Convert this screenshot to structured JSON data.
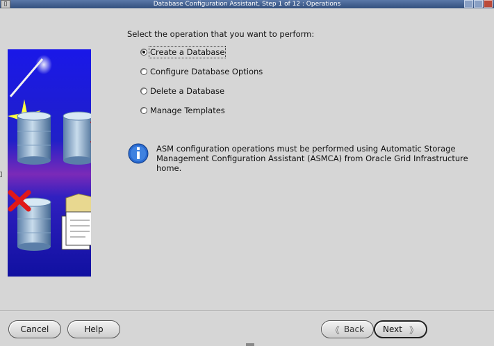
{
  "window": {
    "title": "Database Configuration Assistant, Step 1 of 12 : Operations",
    "icon_glyph": "▯"
  },
  "prompt": "Select the operation that you want to perform:",
  "options": [
    {
      "label": "Create a Database",
      "selected": true
    },
    {
      "label": "Configure Database Options",
      "selected": false
    },
    {
      "label": "Delete a Database",
      "selected": false
    },
    {
      "label": "Manage Templates",
      "selected": false
    }
  ],
  "info": {
    "icon": "info-icon",
    "line1": "ASM configuration operations must be performed using Automatic Storage",
    "line2": "Management Configuration Assistant (ASMCA) from Oracle Grid Infrastructure home."
  },
  "buttons": {
    "cancel": "Cancel",
    "help": "Help",
    "back": "Back",
    "next": "Next",
    "back_arrow": "《",
    "next_arrow": "》"
  },
  "colors": {
    "title_bar": "#3d5a8a",
    "banner_blue": "#2a2ad8",
    "banner_purple": "#7a2ab0",
    "info_blue": "#2a6ad0"
  }
}
